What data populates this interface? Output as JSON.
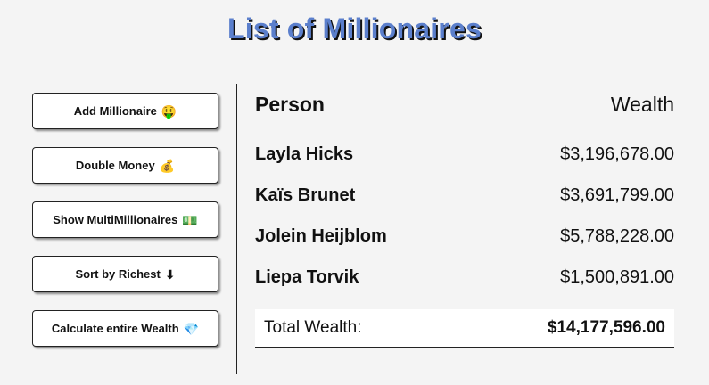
{
  "app": {
    "title": "List of Millionaires"
  },
  "sidebar": {
    "buttons": [
      {
        "label": "Add Millionaire",
        "icon": "🤑",
        "icon_name": "money-face-icon"
      },
      {
        "label": "Double Money",
        "icon": "💰",
        "icon_name": "money-bag-icon"
      },
      {
        "label": "Show MultiMillionaires",
        "icon": "💵",
        "icon_name": "banknote-icon"
      },
      {
        "label": "Sort by Richest",
        "icon": "⬇",
        "icon_name": "down-arrow-icon"
      },
      {
        "label": "Calculate entire Wealth",
        "icon": "💎",
        "icon_name": "gem-icon"
      }
    ]
  },
  "table": {
    "headers": {
      "person": "Person",
      "wealth": "Wealth"
    },
    "rows": [
      {
        "name": "Layla Hicks",
        "wealth": "$3,196,678.00"
      },
      {
        "name": "Kaïs Brunet",
        "wealth": "$3,691,799.00"
      },
      {
        "name": "Jolein Heijblom",
        "wealth": "$5,788,228.00"
      },
      {
        "name": "Liepa Torvik",
        "wealth": "$1,500,891.00"
      }
    ],
    "total": {
      "label": "Total Wealth:",
      "value": "$14,177,596.00"
    }
  },
  "colors": {
    "title": "#5b7fcc",
    "background": "#f4f4f4"
  }
}
